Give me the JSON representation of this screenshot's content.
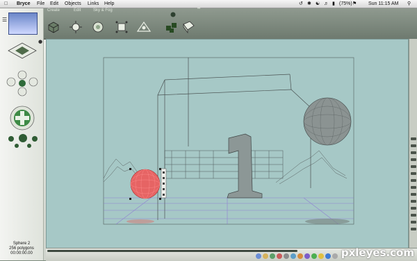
{
  "menubar": {
    "app": "Bryce",
    "items": [
      "File",
      "Edit",
      "Objects",
      "Links",
      "Help"
    ],
    "battery": "(75%)",
    "clock": "Sun 11:15 AM"
  },
  "toolbar": {
    "tabs": [
      "Create",
      "Edit",
      "Sky & Fog"
    ]
  },
  "object_info": {
    "name": "Sphere 2",
    "polygons": "256 polygons",
    "time": "00:00:00.00"
  },
  "watermark": "pxleyes.com",
  "colors": {
    "canvas": "#a6c8c6",
    "chrome": "#6e7a6f",
    "selected_sphere": "#e04444",
    "wireframe": "#555c5c",
    "ground_grid": "#8a6fd6"
  }
}
